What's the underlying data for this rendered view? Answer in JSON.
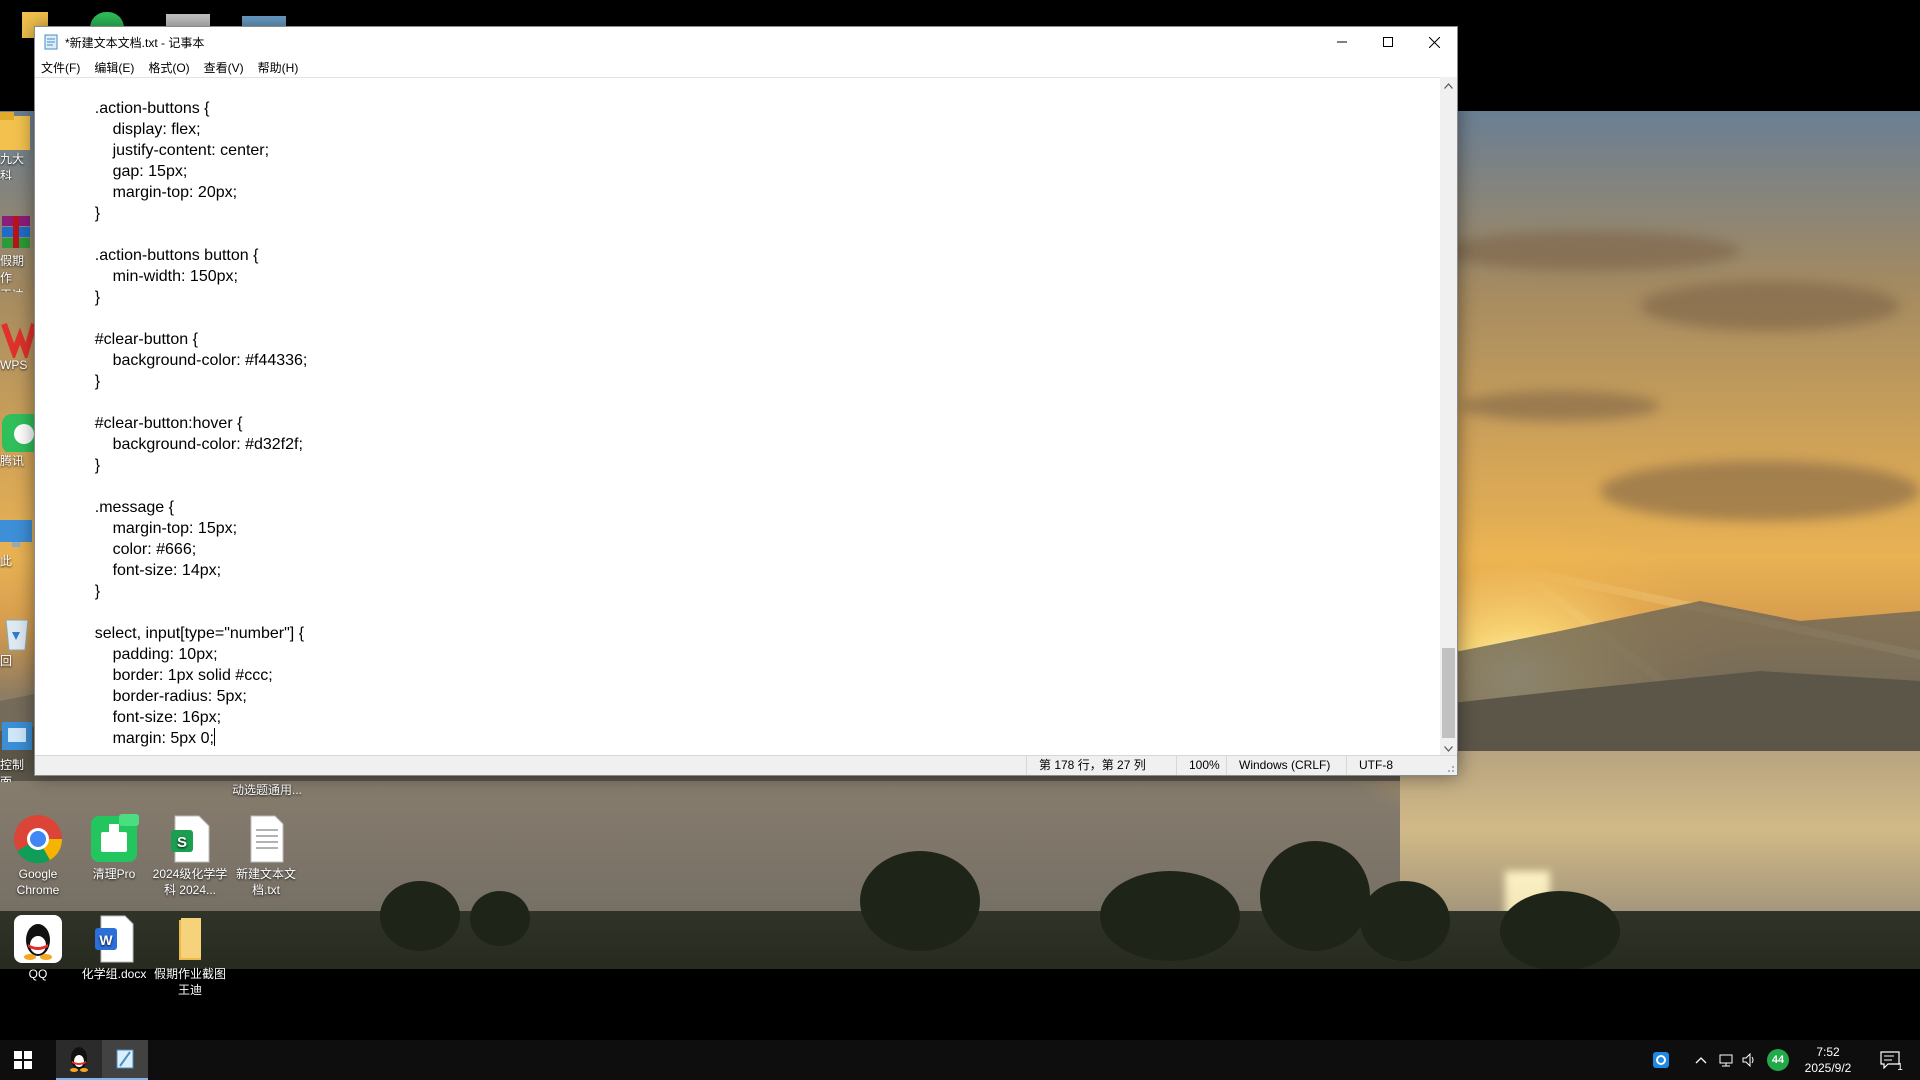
{
  "notepad": {
    "title": "*新建文本文档.txt - 记事本",
    "menu": [
      "文件(F)",
      "编辑(E)",
      "格式(O)",
      "查看(V)",
      "帮助(H)"
    ],
    "code_lines": [
      "    .action-buttons {",
      "        display: flex;",
      "        justify-content: center;",
      "        gap: 15px;",
      "        margin-top: 20px;",
      "    }",
      "",
      "    .action-buttons button {",
      "        min-width: 150px;",
      "    }",
      "",
      "    #clear-button {",
      "        background-color: #f44336;",
      "    }",
      "",
      "    #clear-button:hover {",
      "        background-color: #d32f2f;",
      "    }",
      "",
      "    .message {",
      "        margin-top: 15px;",
      "        color: #666;",
      "        font-size: 14px;",
      "    }",
      "",
      "    select, input[type=\"number\"] {",
      "        padding: 10px;",
      "        border: 1px solid #ccc;",
      "        border-radius: 5px;",
      "        font-size: 16px;",
      "        margin: 5px 0;"
    ],
    "status": {
      "position": "第 178 行，第 27 列",
      "zoom": "100%",
      "line_ending": "Windows (CRLF)",
      "encoding": "UTF-8"
    }
  },
  "desktop": {
    "partial_labels": [
      "九大科",
      "假期作",
      "王迪",
      "WPS",
      "腾讯",
      "此",
      "回",
      "控制面"
    ],
    "hidden_label": "动选题通用...",
    "icons": [
      {
        "label": "Google Chrome",
        "icon": "chrome-icon"
      },
      {
        "label": "清理Pro",
        "icon": "cleaner-pro-icon"
      },
      {
        "label": "2024级化学学科 2024...",
        "icon": "wps-spreadsheet-icon"
      },
      {
        "label": "新建文本文档.txt",
        "icon": "text-file-icon"
      },
      {
        "label": "QQ",
        "icon": "qq-icon"
      },
      {
        "label": "化学组.docx",
        "icon": "word-doc-icon"
      },
      {
        "label": "假期作业截图王迪",
        "icon": "folder-icon"
      }
    ]
  },
  "taskbar": {
    "time": "7:52",
    "date": "2025/9/2",
    "badge_count": "44",
    "notification_count": "1"
  },
  "colors": {
    "accent": "#7fb5e8",
    "taskbar": "#0e0e0e"
  }
}
